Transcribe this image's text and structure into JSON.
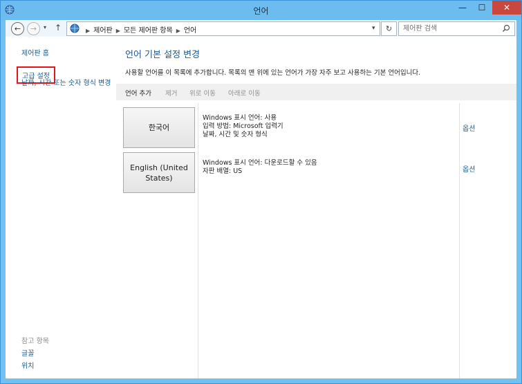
{
  "window": {
    "title": "언어",
    "min_label": "—",
    "max_label": "☐",
    "close_label": "✕"
  },
  "toolbar": {
    "back_icon": "←",
    "forward_icon": "→",
    "recent_icon": "▾",
    "up_icon": "↑",
    "breadcrumbs": [
      "제어판",
      "모든 제어판 항목",
      "언어"
    ],
    "refresh_icon": "↻",
    "search_placeholder": "제어판 검색"
  },
  "sidebar": {
    "home": "제어판 홈",
    "advanced": "고급 설정",
    "date_format": "날짜, 시간 또는 숫자 형식 변경",
    "see_also": "참고 항목",
    "fonts": "글꼴",
    "location": "위치"
  },
  "main": {
    "heading": "언어 기본 설정 변경",
    "description": "사용할 언어를 이 목록에 추가합니다. 목록의 맨 위에 있는 언어가 가장 자주 보고 사용하는 기본 언어입니다.",
    "commands": {
      "add": "언어 추가",
      "remove": "제거",
      "move_up": "위로 이동",
      "move_down": "아래로 이동"
    },
    "languages": [
      {
        "name": "한국어",
        "info": [
          "Windows 표시 언어: 사용",
          "입력 방법: Microsoft 입력기",
          "날짜, 시간 및 숫자 형식"
        ],
        "options": "옵션"
      },
      {
        "name": "English (United States)",
        "info": [
          "Windows 표시 언어: 다운로드할 수 있음",
          "자판 배열: US"
        ],
        "options": "옵션"
      }
    ]
  },
  "colors": {
    "accent": "#1c5a93",
    "title_bar": "#6dbcf0",
    "highlight_border": "#e8131a",
    "close_button": "#c9473c"
  }
}
